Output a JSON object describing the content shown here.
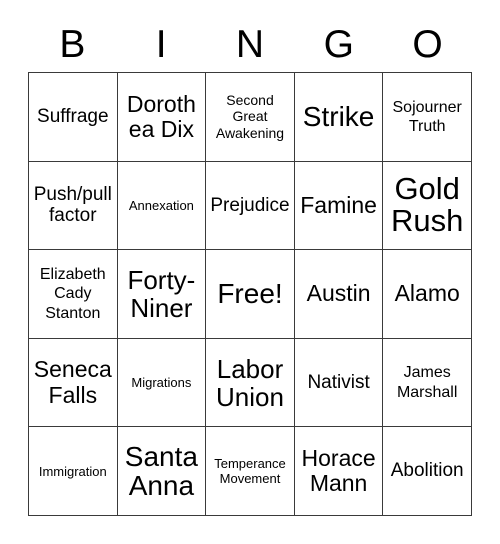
{
  "card": {
    "header_letters": [
      "B",
      "I",
      "N",
      "G",
      "O"
    ],
    "free_space_label": "Free!",
    "rows": [
      [
        {
          "label": "Suffrage",
          "size": "lg"
        },
        {
          "label": "Dorothea Dix",
          "size": "xl"
        },
        {
          "label": "Second Great Awakening",
          "size": "sm"
        },
        {
          "label": "Strike",
          "size": "3xl"
        },
        {
          "label": "Sojourner Truth",
          "size": "md"
        }
      ],
      [
        {
          "label": "Push/pull factor",
          "size": "lg"
        },
        {
          "label": "Annexation",
          "size": "xs"
        },
        {
          "label": "Prejudice",
          "size": "lg"
        },
        {
          "label": "Famine",
          "size": "xl"
        },
        {
          "label": "Gold Rush",
          "size": "4xl"
        }
      ],
      [
        {
          "label": "Elizabeth Cady Stanton",
          "size": "md"
        },
        {
          "label": "Forty-Niner",
          "size": "2xl"
        },
        {
          "label": "Free!",
          "size": "3xl"
        },
        {
          "label": "Austin",
          "size": "xl"
        },
        {
          "label": "Alamo",
          "size": "xl"
        }
      ],
      [
        {
          "label": "Seneca Falls",
          "size": "xl"
        },
        {
          "label": "Migrations",
          "size": "xs"
        },
        {
          "label": "Labor Union",
          "size": "2xl"
        },
        {
          "label": "Nativist",
          "size": "lg"
        },
        {
          "label": "James Marshall",
          "size": "md"
        }
      ],
      [
        {
          "label": "Immigration",
          "size": "xs"
        },
        {
          "label": "Santa Anna",
          "size": "3xl"
        },
        {
          "label": "Temperance Movement",
          "size": "xs"
        },
        {
          "label": "Horace Mann",
          "size": "xl"
        },
        {
          "label": "Abolition",
          "size": "lg"
        }
      ]
    ]
  },
  "colors": {
    "border": "#3a3a3a",
    "cell_background": "#ffffff",
    "text": "#000000",
    "page_background": "#ffffff"
  }
}
